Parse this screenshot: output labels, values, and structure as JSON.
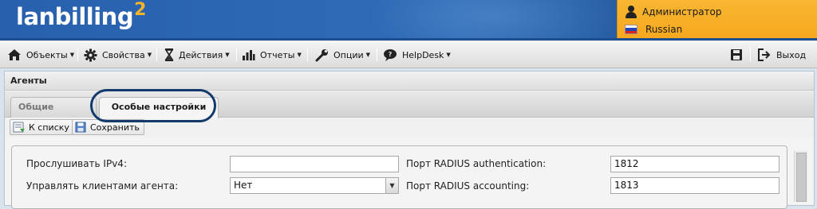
{
  "header": {
    "logo_text": "lanbilling",
    "logo_version": "2",
    "user_name": "Администратор",
    "language": "Russian",
    "accent_color": "#f7ac24",
    "brand_color": "#2c66b0"
  },
  "menu": {
    "items": [
      {
        "label": "Объекты",
        "icon": "home-icon"
      },
      {
        "label": "Свойства",
        "icon": "gear-icon"
      },
      {
        "label": "Действия",
        "icon": "hourglass-icon"
      },
      {
        "label": "Отчеты",
        "icon": "bar-chart-icon"
      },
      {
        "label": "Опции",
        "icon": "wrench-icon"
      },
      {
        "label": "HelpDesk",
        "icon": "chat-icon"
      }
    ],
    "save_icon": "floppy-icon",
    "logout_label": "Выход"
  },
  "panel": {
    "title": "Агенты",
    "tabs": [
      {
        "label": "Общие сведения",
        "active": false
      },
      {
        "label": "Особые настройки",
        "active": true
      }
    ],
    "toolbar": {
      "back_label": "К списку",
      "save_label": "Сохранить"
    },
    "form": {
      "listen_ipv4_label": "Прослушивать IPv4:",
      "listen_ipv4_value": "",
      "manage_clients_label": "Управлять клиентами агента:",
      "manage_clients_value": "Нет",
      "radius_auth_label": "Порт RADIUS authentication:",
      "radius_auth_value": "1812",
      "radius_acct_label": "Порт RADIUS accounting:",
      "radius_acct_value": "1813"
    }
  }
}
